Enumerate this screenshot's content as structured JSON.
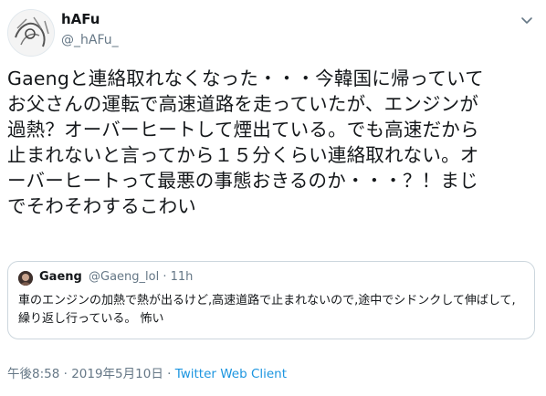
{
  "tweet": {
    "author_name": "hAFu",
    "author_handle": "@_hAFu_",
    "text": "Gaengと連絡取れなくなった・・・今韓国に帰っていて\nお父さんの運転で高速道路を走っていたが、エンジンが\n過熱？オーバーヒートして煙出ている。でも高速だから\n止まれないと言ってから１５分くらい連絡取れない。オ\nーバーヒートって最悪の事態おきるのか・・・？！まじ\nでそわそわするこわい",
    "timestamp": "午後8:58 · 2019年5月10日 · ",
    "client": "Twitter Web Client"
  },
  "quote": {
    "author_name": "Gaeng",
    "meta": "@Gaeng_lol · 11h",
    "text": "車のエンジンの加熱で熱が出るけど,高速道路で止まれないので,途中でシドンクして伸ばして,繰り返し行っている。 怖い"
  },
  "icons": {
    "avatar": "avatar-sketch",
    "more": "chevron-down-icon"
  },
  "colors": {
    "link": "#1b95e0",
    "secondary_text": "#657786",
    "border": "#ccd6dd"
  }
}
